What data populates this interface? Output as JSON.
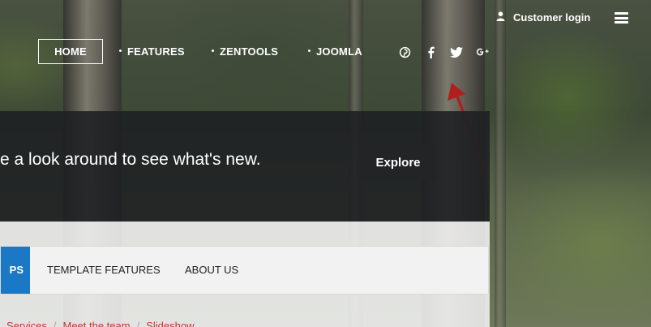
{
  "topbar": {
    "customer_login": "Customer login"
  },
  "nav": {
    "items": [
      {
        "label": "HOME"
      },
      {
        "label": "FEATURES"
      },
      {
        "label": "ZENTOOLS"
      },
      {
        "label": "JOOMLA"
      }
    ]
  },
  "social": {
    "icons": [
      "pinterest-icon",
      "facebook-icon",
      "twitter-icon",
      "google-plus-icon"
    ]
  },
  "banner": {
    "text": "e a look around to see what's new.",
    "button": "Explore"
  },
  "tabs": {
    "items": [
      {
        "label": "PS"
      },
      {
        "label": "TEMPLATE FEATURES"
      },
      {
        "label": "ABOUT US"
      }
    ]
  },
  "links": {
    "items": [
      "Services",
      "Meet the team",
      "Slideshow"
    ],
    "separator": "/"
  },
  "colors": {
    "active_tab": "#1a78c4",
    "link_red": "#cc3333",
    "annotation_arrow": "#b01e1e"
  }
}
